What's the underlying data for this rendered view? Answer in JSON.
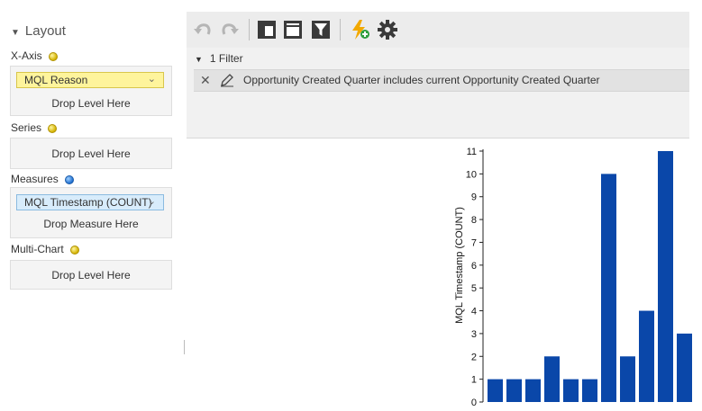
{
  "layout": {
    "title": "Layout",
    "xaxis": {
      "label": "X-Axis",
      "field": "MQL Reason",
      "drop": "Drop Level Here"
    },
    "series": {
      "label": "Series",
      "drop": "Drop Level Here"
    },
    "measures": {
      "label": "Measures",
      "field": "MQL Timestamp (COUNT)",
      "drop": "Drop Measure Here"
    },
    "multichart": {
      "label": "Multi-Chart",
      "drop": "Drop Level Here"
    }
  },
  "toolbar": {
    "icons": [
      "undo-icon",
      "redo-icon",
      "layout-panel-icon",
      "table-view-icon",
      "filter-icon",
      "add-lightning-icon",
      "settings-gear-icon"
    ]
  },
  "filters": {
    "header": "1 Filter",
    "items": [
      {
        "text": "Opportunity Created Quarter includes current Opportunity Created Quarter"
      }
    ]
  },
  "chart_data": {
    "type": "bar",
    "ylabel": "MQL Timestamp (COUNT)",
    "ylim": [
      0,
      11
    ],
    "yticks": [
      0,
      1,
      2,
      3,
      4,
      5,
      6,
      7,
      8,
      9,
      10,
      11
    ],
    "values": [
      1,
      1,
      1,
      2,
      1,
      1,
      10,
      2,
      4,
      11,
      3
    ],
    "bar_color": "#0a47a9",
    "grid": false
  },
  "colors": {
    "toolbar_bg": "#ececec",
    "filter_bg": "#f1f1f1",
    "chip_yellow": "#fef49c",
    "chip_blue": "#d8ecfb",
    "accent_orange": "#f2a900",
    "accent_green": "#2e9e3e"
  }
}
